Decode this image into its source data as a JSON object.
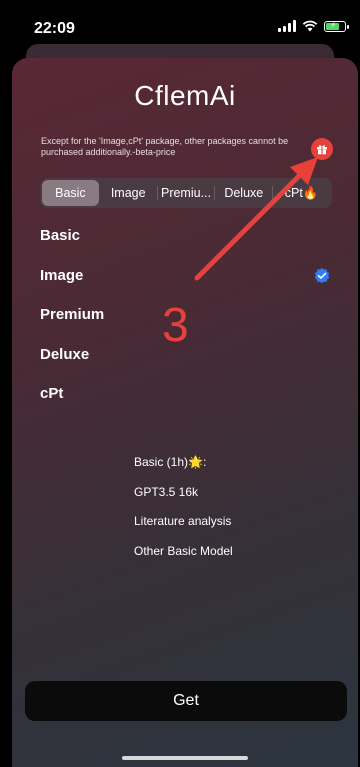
{
  "status": {
    "time": "22:09",
    "icons": [
      "signal-icon",
      "wifi-icon",
      "battery-charging-icon"
    ]
  },
  "app": {
    "title": "CflemAi",
    "notice": "Except for the 'Image,cPt' package, other packages cannot be purchased additionally.-beta-price"
  },
  "tabs": [
    {
      "label": "Basic",
      "active": true
    },
    {
      "label": "Image",
      "active": false
    },
    {
      "label": "Premiu...",
      "active": false
    },
    {
      "label": "Deluxe",
      "active": false
    },
    {
      "label": "cPt🔥",
      "active": false
    }
  ],
  "packages": [
    {
      "label": "Basic",
      "verified": false
    },
    {
      "label": "Image",
      "verified": true
    },
    {
      "label": "Premium",
      "verified": false
    },
    {
      "label": "Deluxe",
      "verified": false
    },
    {
      "label": "cPt",
      "verified": false
    }
  ],
  "annotation": {
    "number": "3",
    "color": "#e8413a"
  },
  "features": {
    "header": "Basic (1h)🌟:",
    "items": [
      "GPT3.5 16k",
      "Literature analysis",
      "Other Basic Model"
    ]
  },
  "actions": {
    "get_label": "Get"
  },
  "colors": {
    "accent_red": "#e8413a",
    "verified_blue": "#2f7cf6",
    "button_bg": "#0b0b0b"
  }
}
